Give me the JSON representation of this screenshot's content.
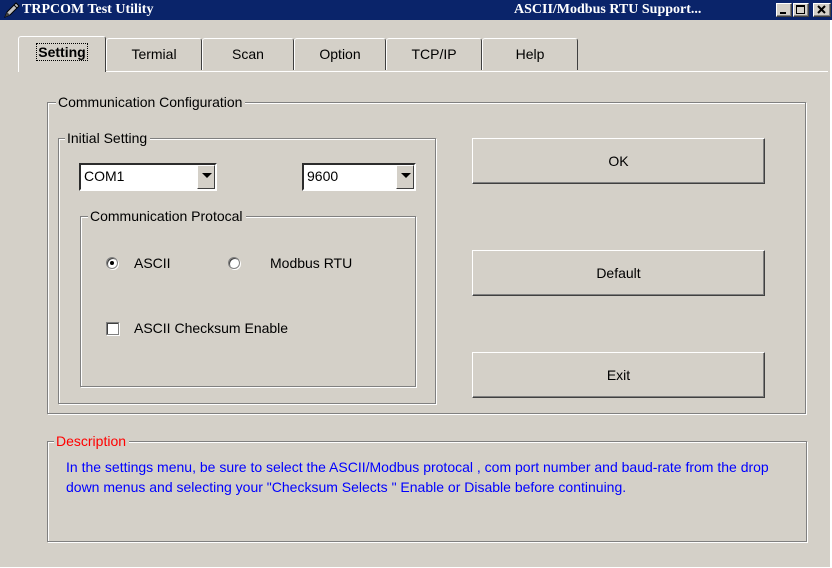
{
  "window": {
    "title_left": "TRPCOM Test Utility",
    "title_right": "ASCII/Modbus RTU Support..."
  },
  "tabs": [
    "Setting",
    "Termial",
    "Scan",
    "Option",
    "TCP/IP",
    "Help"
  ],
  "comm_config": {
    "legend": "Communication Configuration",
    "initial_setting": {
      "legend": "Initial Setting",
      "port_value": "COM1",
      "baud_value": "9600"
    },
    "protocol": {
      "legend": "Communication Protocal",
      "ascii_label": "ASCII",
      "modbus_label": "Modbus RTU",
      "selected": "ASCII"
    },
    "checksum_label": "ASCII Checksum Enable",
    "checksum_checked": false
  },
  "buttons": {
    "ok": "OK",
    "default": "Default",
    "exit": "Exit"
  },
  "description": {
    "legend": "Description",
    "text": "In the settings menu, be sure to select the ASCII/Modbus protocal , com port number and baud-rate from the drop down menus and selecting your \"Checksum Selects \" Enable or Disable before continuing.",
    "legend_color": "#ff0000",
    "text_color": "#0000ff"
  },
  "colors": {
    "titlebar": "#0a246a",
    "face": "#d4d0c8"
  }
}
